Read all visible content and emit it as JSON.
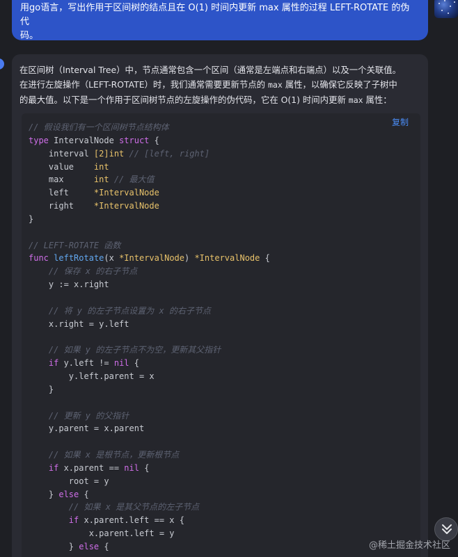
{
  "user_message": {
    "lines": [
      "用go语言，写出作用于区间树的结点且在 O(1) 时间内更新 max 属性的过程 LEFT-ROTATE 的伪代",
      "码。"
    ]
  },
  "assistant_message": {
    "intro": [
      {
        "segments": [
          {
            "t": "在区间树（Interval Tree）中，节点通常包含一个区间（通常是左端点和右端点）以及一个关联值。",
            "mono": false
          }
        ]
      },
      {
        "segments": [
          {
            "t": "在进行左旋操作（LEFT-ROTATE）时，我们通常需要更新节点的 ",
            "mono": false
          },
          {
            "t": "max",
            "mono": true
          },
          {
            "t": " 属性，以确保它反映了子树中",
            "mono": false
          }
        ]
      },
      {
        "segments": [
          {
            "t": "的最大值。以下是一个作用于区间树节点的左旋操作的伪代码，它在 O(1) 时间内更新 ",
            "mono": false
          },
          {
            "t": "max",
            "mono": true
          },
          {
            "t": " 属性：",
            "mono": false
          }
        ]
      }
    ],
    "copy_label": "复制",
    "code_lines": [
      [
        {
          "t": "// 假设我们有一个区间树节点结构体",
          "k": "cm"
        }
      ],
      [
        {
          "t": "type",
          "k": "kw"
        },
        {
          "t": " IntervalNode ",
          "k": "pl"
        },
        {
          "t": "struct",
          "k": "kw"
        },
        {
          "t": " {",
          "k": "pl"
        }
      ],
      [
        {
          "t": "    interval ",
          "k": "pl"
        },
        {
          "t": "[2]int",
          "k": "ty"
        },
        {
          "t": " // [left, right]",
          "k": "cm"
        }
      ],
      [
        {
          "t": "    value    ",
          "k": "pl"
        },
        {
          "t": "int",
          "k": "ty"
        }
      ],
      [
        {
          "t": "    max      ",
          "k": "pl"
        },
        {
          "t": "int",
          "k": "ty"
        },
        {
          "t": " // 最大值",
          "k": "cm"
        }
      ],
      [
        {
          "t": "    left     ",
          "k": "pl"
        },
        {
          "t": "*IntervalNode",
          "k": "ty"
        }
      ],
      [
        {
          "t": "    right    ",
          "k": "pl"
        },
        {
          "t": "*IntervalNode",
          "k": "ty"
        }
      ],
      [
        {
          "t": "}",
          "k": "pl"
        }
      ],
      [],
      [
        {
          "t": "// LEFT-ROTATE 函数",
          "k": "cm"
        }
      ],
      [
        {
          "t": "func",
          "k": "kw"
        },
        {
          "t": " ",
          "k": "pl"
        },
        {
          "t": "leftRotate",
          "k": "fn"
        },
        {
          "t": "(x ",
          "k": "pl"
        },
        {
          "t": "*IntervalNode",
          "k": "ty"
        },
        {
          "t": ") ",
          "k": "pl"
        },
        {
          "t": "*IntervalNode",
          "k": "ty"
        },
        {
          "t": " {",
          "k": "pl"
        }
      ],
      [
        {
          "t": "    // 保存 x 的右子节点",
          "k": "cm"
        }
      ],
      [
        {
          "t": "    y := x.right",
          "k": "pl"
        }
      ],
      [],
      [
        {
          "t": "    // 将 y 的左子节点设置为 x 的右子节点",
          "k": "cm"
        }
      ],
      [
        {
          "t": "    x.right = y.left",
          "k": "pl"
        }
      ],
      [],
      [
        {
          "t": "    // 如果 y 的左子节点不为空，更新其父指针",
          "k": "cm"
        }
      ],
      [
        {
          "t": "    ",
          "k": "pl"
        },
        {
          "t": "if",
          "k": "kw"
        },
        {
          "t": " y.left != ",
          "k": "pl"
        },
        {
          "t": "nil",
          "k": "kw"
        },
        {
          "t": " {",
          "k": "pl"
        }
      ],
      [
        {
          "t": "        y.left.parent = x",
          "k": "pl"
        }
      ],
      [
        {
          "t": "    }",
          "k": "pl"
        }
      ],
      [],
      [
        {
          "t": "    // 更新 y 的父指针",
          "k": "cm"
        }
      ],
      [
        {
          "t": "    y.parent = x.parent",
          "k": "pl"
        }
      ],
      [],
      [
        {
          "t": "    // 如果 x 是根节点，更新根节点",
          "k": "cm"
        }
      ],
      [
        {
          "t": "    ",
          "k": "pl"
        },
        {
          "t": "if",
          "k": "kw"
        },
        {
          "t": " x.parent == ",
          "k": "pl"
        },
        {
          "t": "nil",
          "k": "kw"
        },
        {
          "t": " {",
          "k": "pl"
        }
      ],
      [
        {
          "t": "        root = y",
          "k": "pl"
        }
      ],
      [
        {
          "t": "    } ",
          "k": "pl"
        },
        {
          "t": "else",
          "k": "kw"
        },
        {
          "t": " {",
          "k": "pl"
        }
      ],
      [
        {
          "t": "        // 如果 x 是其父节点的左子节点",
          "k": "cm"
        }
      ],
      [
        {
          "t": "        ",
          "k": "pl"
        },
        {
          "t": "if",
          "k": "kw"
        },
        {
          "t": " x.parent.left == x {",
          "k": "pl"
        }
      ],
      [
        {
          "t": "            x.parent.left = y",
          "k": "pl"
        }
      ],
      [
        {
          "t": "        } ",
          "k": "pl"
        },
        {
          "t": "else",
          "k": "kw"
        },
        {
          "t": " {",
          "k": "pl"
        }
      ]
    ]
  },
  "scroll_button_icon": "double-chevron-down-icon",
  "watermark": "@稀土掘金技术社区",
  "colors": {
    "user_bubble": "#2d54c8",
    "keyword": "#cf6ee8",
    "comment": "#5d6272",
    "type": "#e8c26a",
    "function": "#62a8f0",
    "link": "#4a8cf5"
  }
}
